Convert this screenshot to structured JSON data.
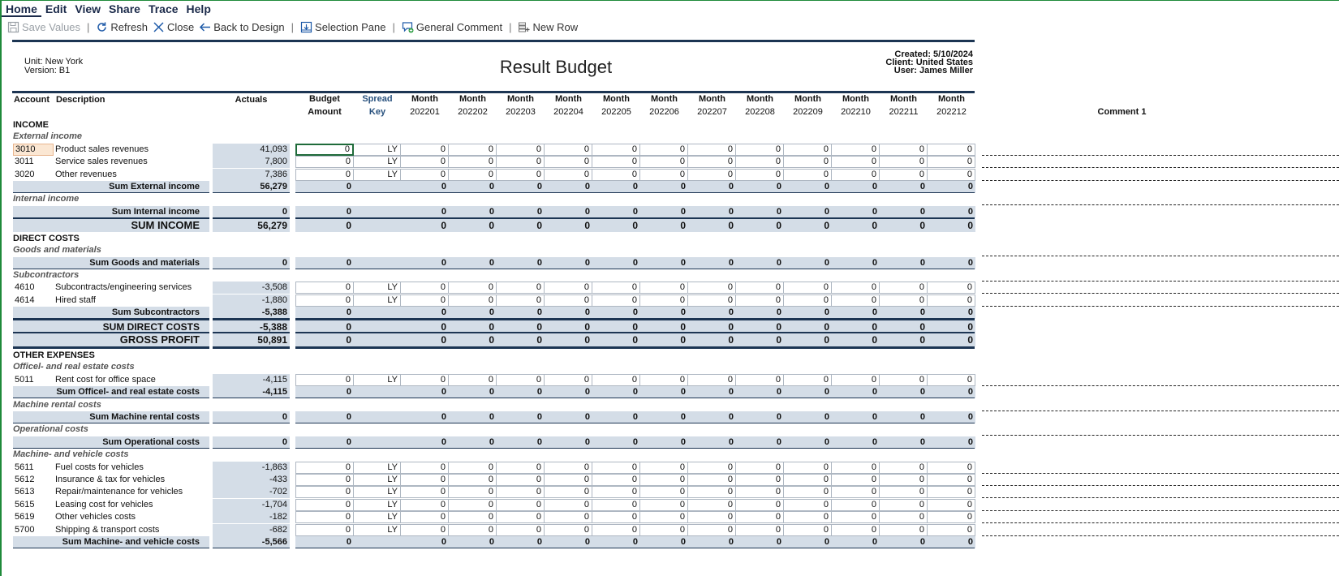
{
  "menu": [
    {
      "label": "Home",
      "active": true
    },
    {
      "label": "Edit"
    },
    {
      "label": "View"
    },
    {
      "label": "Share"
    },
    {
      "label": "Trace"
    },
    {
      "label": "Help"
    }
  ],
  "toolbar": {
    "save_values": "Save Values",
    "refresh": "Refresh",
    "close": "Close",
    "back_to_design": "Back to Design",
    "selection_pane": "Selection Pane",
    "general_comment": "General Comment",
    "new_row": "New Row"
  },
  "report": {
    "title": "Result Budget",
    "unit": "Unit: New York",
    "version": "Version: B1",
    "created": "Created: 5/10/2024",
    "client": "Client: United States",
    "user": "User: James Miller"
  },
  "columns": {
    "account": "Account",
    "description": "Description",
    "actuals": "Actuals",
    "budget_l1": "Budget",
    "budget_l2": "Amount",
    "spread_l1": "Spread",
    "spread_l2": "Key",
    "month_label": "Month",
    "months": [
      "202201",
      "202202",
      "202203",
      "202204",
      "202205",
      "202206",
      "202207",
      "202208",
      "202209",
      "202210",
      "202211",
      "202212"
    ],
    "comment": "Comment 1"
  },
  "rows": [
    {
      "type": "section",
      "label": "INCOME"
    },
    {
      "type": "group",
      "label": "External income"
    },
    {
      "type": "data",
      "account": "3010",
      "description": "Product sales revenues",
      "actuals": "41,093",
      "budget": "0",
      "spread": "LY",
      "months": [
        "0",
        "0",
        "0",
        "0",
        "0",
        "0",
        "0",
        "0",
        "0",
        "0",
        "0",
        "0"
      ],
      "selected": true
    },
    {
      "type": "data",
      "account": "3011",
      "description": "Service sales revenues",
      "actuals": "7,800",
      "budget": "0",
      "spread": "LY",
      "months": [
        "0",
        "0",
        "0",
        "0",
        "0",
        "0",
        "0",
        "0",
        "0",
        "0",
        "0",
        "0"
      ]
    },
    {
      "type": "data",
      "account": "3020",
      "description": "Other revenues",
      "actuals": "7,386",
      "budget": "0",
      "spread": "LY",
      "months": [
        "0",
        "0",
        "0",
        "0",
        "0",
        "0",
        "0",
        "0",
        "0",
        "0",
        "0",
        "0"
      ]
    },
    {
      "type": "sum",
      "label": "Sum External income",
      "actuals": "56,279",
      "budget": "0",
      "months": [
        "0",
        "0",
        "0",
        "0",
        "0",
        "0",
        "0",
        "0",
        "0",
        "0",
        "0",
        "0"
      ]
    },
    {
      "type": "group",
      "label": "Internal income",
      "comment": true
    },
    {
      "type": "sum",
      "label": "Sum Internal income",
      "actuals": "0",
      "budget": "0",
      "months": [
        "0",
        "0",
        "0",
        "0",
        "0",
        "0",
        "0",
        "0",
        "0",
        "0",
        "0",
        "0"
      ]
    },
    {
      "type": "total",
      "label": "SUM INCOME",
      "actuals": "56,279",
      "budget": "0",
      "months": [
        "0",
        "0",
        "0",
        "0",
        "0",
        "0",
        "0",
        "0",
        "0",
        "0",
        "0",
        "0"
      ]
    },
    {
      "type": "section",
      "label": "DIRECT COSTS"
    },
    {
      "type": "group",
      "label": "Goods and materials",
      "comment": true
    },
    {
      "type": "sum",
      "label": "Sum Goods and materials",
      "actuals": "0",
      "budget": "0",
      "months": [
        "0",
        "0",
        "0",
        "0",
        "0",
        "0",
        "0",
        "0",
        "0",
        "0",
        "0",
        "0"
      ]
    },
    {
      "type": "group",
      "label": "Subcontractors",
      "comment": true
    },
    {
      "type": "data",
      "account": "4610",
      "description": "Subcontracts/engineering services",
      "actuals": "-3,508",
      "budget": "0",
      "spread": "LY",
      "months": [
        "0",
        "0",
        "0",
        "0",
        "0",
        "0",
        "0",
        "0",
        "0",
        "0",
        "0",
        "0"
      ]
    },
    {
      "type": "data",
      "account": "4614",
      "description": "Hired staff",
      "actuals": "-1,880",
      "budget": "0",
      "spread": "LY",
      "months": [
        "0",
        "0",
        "0",
        "0",
        "0",
        "0",
        "0",
        "0",
        "0",
        "0",
        "0",
        "0"
      ]
    },
    {
      "type": "sum",
      "label": "Sum Subcontractors",
      "actuals": "-5,388",
      "budget": "0",
      "months": [
        "0",
        "0",
        "0",
        "0",
        "0",
        "0",
        "0",
        "0",
        "0",
        "0",
        "0",
        "0"
      ]
    },
    {
      "type": "total",
      "label": "SUM DIRECT COSTS",
      "actuals": "-5,388",
      "budget": "0",
      "months": [
        "0",
        "0",
        "0",
        "0",
        "0",
        "0",
        "0",
        "0",
        "0",
        "0",
        "0",
        "0"
      ],
      "small": true
    },
    {
      "type": "total",
      "label": "GROSS PROFIT",
      "actuals": "50,891",
      "budget": "0",
      "months": [
        "0",
        "0",
        "0",
        "0",
        "0",
        "0",
        "0",
        "0",
        "0",
        "0",
        "0",
        "0"
      ],
      "double": true
    },
    {
      "type": "section",
      "label": "OTHER EXPENSES"
    },
    {
      "type": "group",
      "label": "Officel- and real estate costs"
    },
    {
      "type": "data",
      "account": "5011",
      "description": "Rent cost for office space",
      "actuals": "-4,115",
      "budget": "0",
      "spread": "LY",
      "months": [
        "0",
        "0",
        "0",
        "0",
        "0",
        "0",
        "0",
        "0",
        "0",
        "0",
        "0",
        "0"
      ]
    },
    {
      "type": "sum",
      "label": "Sum Officel- and real estate costs",
      "actuals": "-4,115",
      "budget": "0",
      "months": [
        "0",
        "0",
        "0",
        "0",
        "0",
        "0",
        "0",
        "0",
        "0",
        "0",
        "0",
        "0"
      ]
    },
    {
      "type": "group",
      "label": "Machine rental costs",
      "comment": true
    },
    {
      "type": "sum",
      "label": "Sum Machine rental costs",
      "actuals": "0",
      "budget": "0",
      "months": [
        "0",
        "0",
        "0",
        "0",
        "0",
        "0",
        "0",
        "0",
        "0",
        "0",
        "0",
        "0"
      ]
    },
    {
      "type": "group",
      "label": "Operational costs",
      "comment": true
    },
    {
      "type": "sum",
      "label": "Sum Operational costs",
      "actuals": "0",
      "budget": "0",
      "months": [
        "0",
        "0",
        "0",
        "0",
        "0",
        "0",
        "0",
        "0",
        "0",
        "0",
        "0",
        "0"
      ]
    },
    {
      "type": "group",
      "label": "Machine- and vehicle costs"
    },
    {
      "type": "data",
      "account": "5611",
      "description": "Fuel costs for vehicles",
      "actuals": "-1,863",
      "budget": "0",
      "spread": "LY",
      "months": [
        "0",
        "0",
        "0",
        "0",
        "0",
        "0",
        "0",
        "0",
        "0",
        "0",
        "0",
        "0"
      ]
    },
    {
      "type": "data",
      "account": "5612",
      "description": "Insurance & tax for vehicles",
      "actuals": "-433",
      "budget": "0",
      "spread": "LY",
      "months": [
        "0",
        "0",
        "0",
        "0",
        "0",
        "0",
        "0",
        "0",
        "0",
        "0",
        "0",
        "0"
      ]
    },
    {
      "type": "data",
      "account": "5613",
      "description": "Repair/maintenance for vehicles",
      "actuals": "-702",
      "budget": "0",
      "spread": "LY",
      "months": [
        "0",
        "0",
        "0",
        "0",
        "0",
        "0",
        "0",
        "0",
        "0",
        "0",
        "0",
        "0"
      ]
    },
    {
      "type": "data",
      "account": "5615",
      "description": "Leasing cost for vehicles",
      "actuals": "-1,704",
      "budget": "0",
      "spread": "LY",
      "months": [
        "0",
        "0",
        "0",
        "0",
        "0",
        "0",
        "0",
        "0",
        "0",
        "0",
        "0",
        "0"
      ]
    },
    {
      "type": "data",
      "account": "5619",
      "description": "Other vehicles costs",
      "actuals": "-182",
      "budget": "0",
      "spread": "LY",
      "months": [
        "0",
        "0",
        "0",
        "0",
        "0",
        "0",
        "0",
        "0",
        "0",
        "0",
        "0",
        "0"
      ]
    },
    {
      "type": "data",
      "account": "5700",
      "description": "Shipping & transport costs",
      "actuals": "-682",
      "budget": "0",
      "spread": "LY",
      "months": [
        "0",
        "0",
        "0",
        "0",
        "0",
        "0",
        "0",
        "0",
        "0",
        "0",
        "0",
        "0"
      ]
    },
    {
      "type": "sum",
      "label": "Sum Machine- and vehicle costs",
      "actuals": "-5,566",
      "budget": "0",
      "months": [
        "0",
        "0",
        "0",
        "0",
        "0",
        "0",
        "0",
        "0",
        "0",
        "0",
        "0",
        "0"
      ]
    }
  ]
}
